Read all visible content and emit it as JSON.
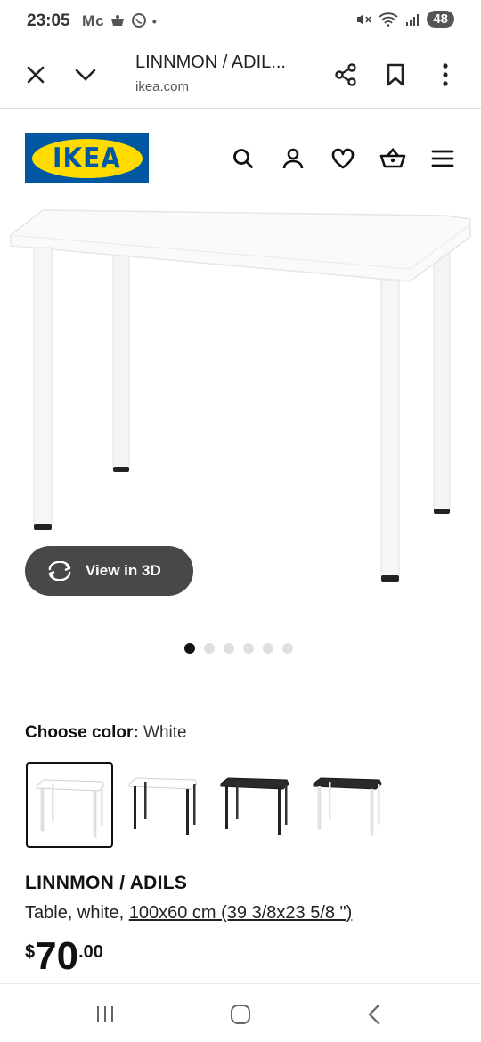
{
  "status": {
    "time": "23:05",
    "notifications": "Mᴄ",
    "battery": "48"
  },
  "browser": {
    "title": "LINNMON / ADIL...",
    "url": "ikea.com"
  },
  "site": {
    "logo_text": "IKEA"
  },
  "media": {
    "view3d_label": "View in 3D",
    "dot_count": 6,
    "active_dot": 0
  },
  "product": {
    "choose_color_label": "Choose color:",
    "color_value": "White",
    "name": "LINNMON / ADILS",
    "desc_prefix": "Table, white, ",
    "desc_size": "100x60 cm (39 3/8x23 5/8 \")",
    "price_currency": "$",
    "price_integer": "70",
    "price_decimal": ".00"
  },
  "swatches": [
    {
      "name": "white-white",
      "top": "#ffffff",
      "legs": "#e8e8e8",
      "selected": true
    },
    {
      "name": "white-black",
      "top": "#ffffff",
      "legs": "#222222",
      "selected": false
    },
    {
      "name": "black-black",
      "top": "#2a2a2a",
      "legs": "#222222",
      "selected": false
    },
    {
      "name": "black-white",
      "top": "#2a2a2a",
      "legs": "#e8e8e8",
      "selected": false
    }
  ],
  "colors": {
    "brand_blue": "#0058a3",
    "brand_yellow": "#ffdb00",
    "button_dark": "#484848"
  }
}
